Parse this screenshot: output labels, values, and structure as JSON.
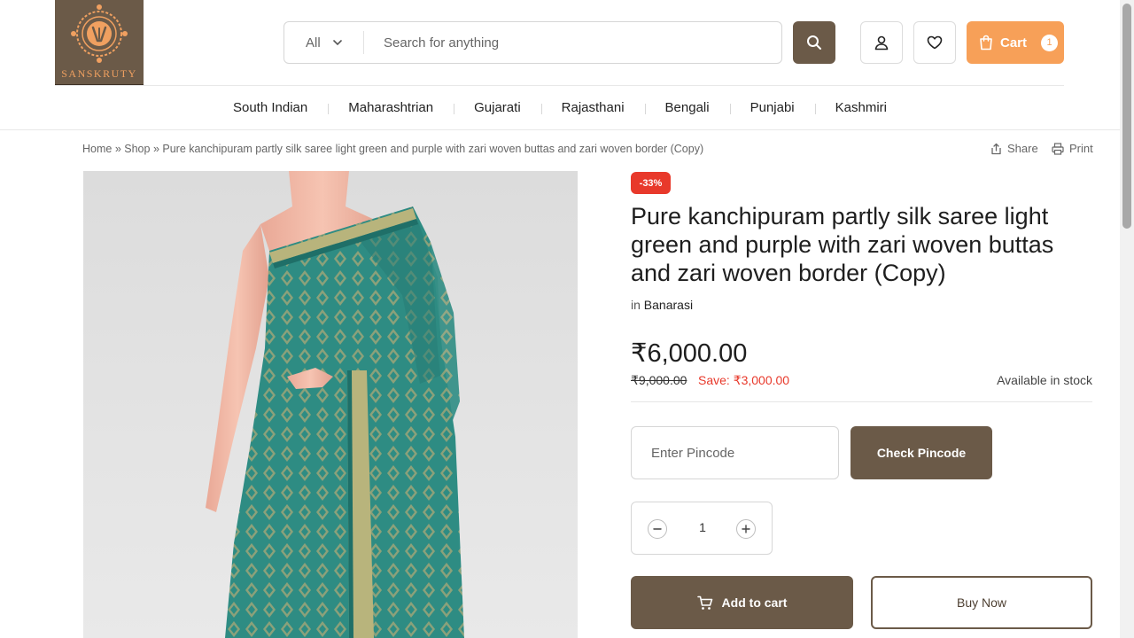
{
  "brand": {
    "name": "SANSKRUTY",
    "colors": {
      "primary": "#6b5a48",
      "accent": "#f7a058",
      "sale": "#e8392b"
    }
  },
  "header": {
    "search": {
      "category": "All",
      "placeholder": "Search for anything"
    },
    "cart": {
      "label": "Cart",
      "count": "1"
    },
    "icons": [
      "search-icon",
      "user-icon",
      "heart-icon",
      "shopping-bag-icon"
    ]
  },
  "nav": {
    "items": [
      "South Indian",
      "Maharashtrian",
      "Gujarati",
      "Rajasthani",
      "Bengali",
      "Punjabi",
      "Kashmiri"
    ]
  },
  "breadcrumb": {
    "home": "Home",
    "sep1": "»",
    "shop": "Shop",
    "sep2": "»",
    "current": "Pure kanchipuram partly silk saree light green and purple with zari woven buttas and zari woven border (Copy)"
  },
  "actions": {
    "share": "Share",
    "print": "Print"
  },
  "product": {
    "discount": "-33%",
    "title": "Pure kanchipuram partly silk saree light green and purple with zari woven buttas and zari woven border (Copy)",
    "category_prefix": "in",
    "category": "Banarasi",
    "price": "₹6,000.00",
    "old_price": "₹9,000.00",
    "save": "Save: ₹3,000.00",
    "stock": "Available in stock",
    "pincode_placeholder": "Enter Pincode",
    "check_pincode": "Check Pincode",
    "quantity": "1",
    "add_to_cart": "Add to cart",
    "buy_now": "Buy Now"
  }
}
